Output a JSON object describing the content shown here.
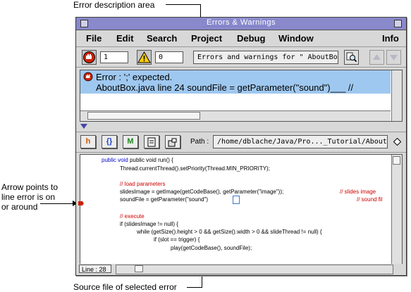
{
  "annotations": {
    "error_description": "Error description area",
    "arrow_points": [
      "Arrow points to",
      "line error is on",
      "or around"
    ],
    "source_file": "Source file of selected error"
  },
  "window": {
    "title": "Errors & Warnings"
  },
  "menu": [
    "File",
    "Edit",
    "Search",
    "Project",
    "Debug",
    "Window",
    "Info"
  ],
  "toolbar": {
    "error_count": "1",
    "warning_count": "0",
    "description": "Errors and warnings for \" AboutBox.mcp \""
  },
  "error_list": {
    "selected_line_1": "Error   : ';' expected.",
    "selected_line_2": "AboutBox.java line 24     soundFile = getParameter(\"sound\")___     //"
  },
  "source_toolbar": {
    "path_label": "Path :",
    "path_value": "/home/dblache/Java/Pro..._Tutorial/AboutBox.java"
  },
  "source_code": {
    "lines": [
      "public void run() {",
      "Thread.currentThread().setPriority(Thread.MIN_PRIORITY);",
      "",
      "// load parameters",
      "slidesImage = getImage(getCodeBase(), getParameter(\"image\"));",
      "soundFile = getParameter(\"sound\")",
      "",
      "// execute",
      "if (slidesImage != null) {",
      "while (getSize().height > 0 && getSize().width > 0 && slideThread != null) {",
      "if (slot == trigger) {",
      "play(getCodeBase(), soundFile);"
    ],
    "comment_slides": "// slides image",
    "comment_sound": "// sound fil"
  },
  "status": {
    "line_label": "Line : 28"
  },
  "colors": {
    "selection": "#9fc8f0",
    "title_bar": "#8888cc",
    "keyword": "#0000cc",
    "comment": "#cc0000",
    "error_marker": "#cc2200"
  }
}
